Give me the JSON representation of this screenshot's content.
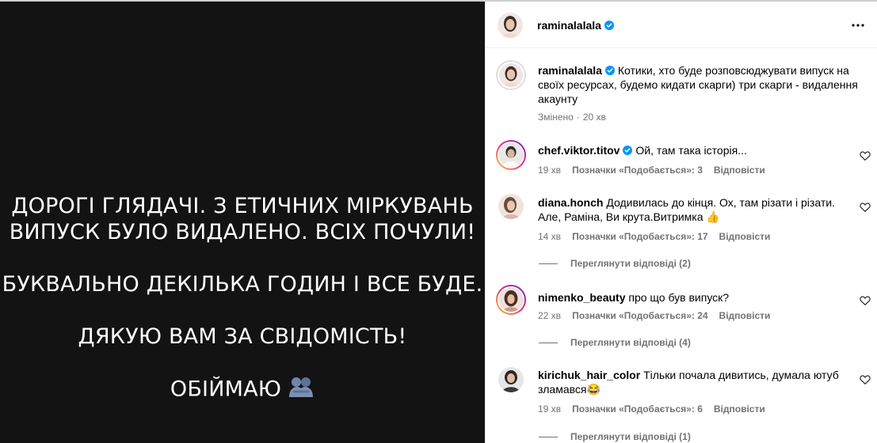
{
  "story": {
    "lines": [
      "ДОРОГІ ГЛЯДАЧІ. З ЕТИЧНИХ МІРКУВАНЬ",
      "ВИПУСК БУЛО ВИДАЛЕНО. ВСІХ ПОЧУЛИ!",
      "БУКВАЛЬНО ДЕКІЛЬКА ГОДИН І ВСЕ БУДЕ.",
      "ДЯКУЮ ВАМ ЗА СВІДОМІСТЬ!",
      "ОБІЙМАЮ"
    ],
    "emoji_icon": "people-hugging-icon"
  },
  "header": {
    "username": "raminalalala",
    "verified": true,
    "more_icon": "more-horizontal-icon"
  },
  "caption": {
    "username": "raminalalala",
    "text": "Котики, хто буде розповсюджувати випуск на своїх ресурсах, будемо кидати скарги) три скарги - видалення акаунту",
    "edited": "Змінено",
    "time": "20 хв"
  },
  "comments": [
    {
      "username": "chef.viktor.titov",
      "verified": true,
      "text": "Ой, там така історія...",
      "time": "19 хв",
      "likes": "Позначки «Подобається»: 3",
      "reply": "Відповісти",
      "view_replies": ""
    },
    {
      "username": "diana.honch",
      "verified": false,
      "text": "Додивилась до кінця. Ох, там різати і різати. Але, Раміна, Ви крута.Витримка 👍",
      "time": "14 хв",
      "likes": "Позначки «Подобається»: 17",
      "reply": "Відповісти",
      "view_replies": "Переглянути відповіді (2)"
    },
    {
      "username": "nimenko_beauty",
      "verified": false,
      "text": "про що був випуск?",
      "time": "22 хв",
      "likes": "Позначки «Подобається»: 24",
      "reply": "Відповісти",
      "view_replies": "Переглянути відповіді (4)"
    },
    {
      "username": "kirichuk_hair_color",
      "verified": false,
      "text": "Тільки почала дивитись, думала ютуб зламався😂",
      "time": "19 хв",
      "likes": "Позначки «Подобається»: 6",
      "reply": "Відповісти",
      "view_replies": "Переглянути відповіді (1)"
    }
  ],
  "colors": {
    "story_bg": "#131313",
    "verified_blue": "#0095f6",
    "meta_gray": "#737373"
  }
}
